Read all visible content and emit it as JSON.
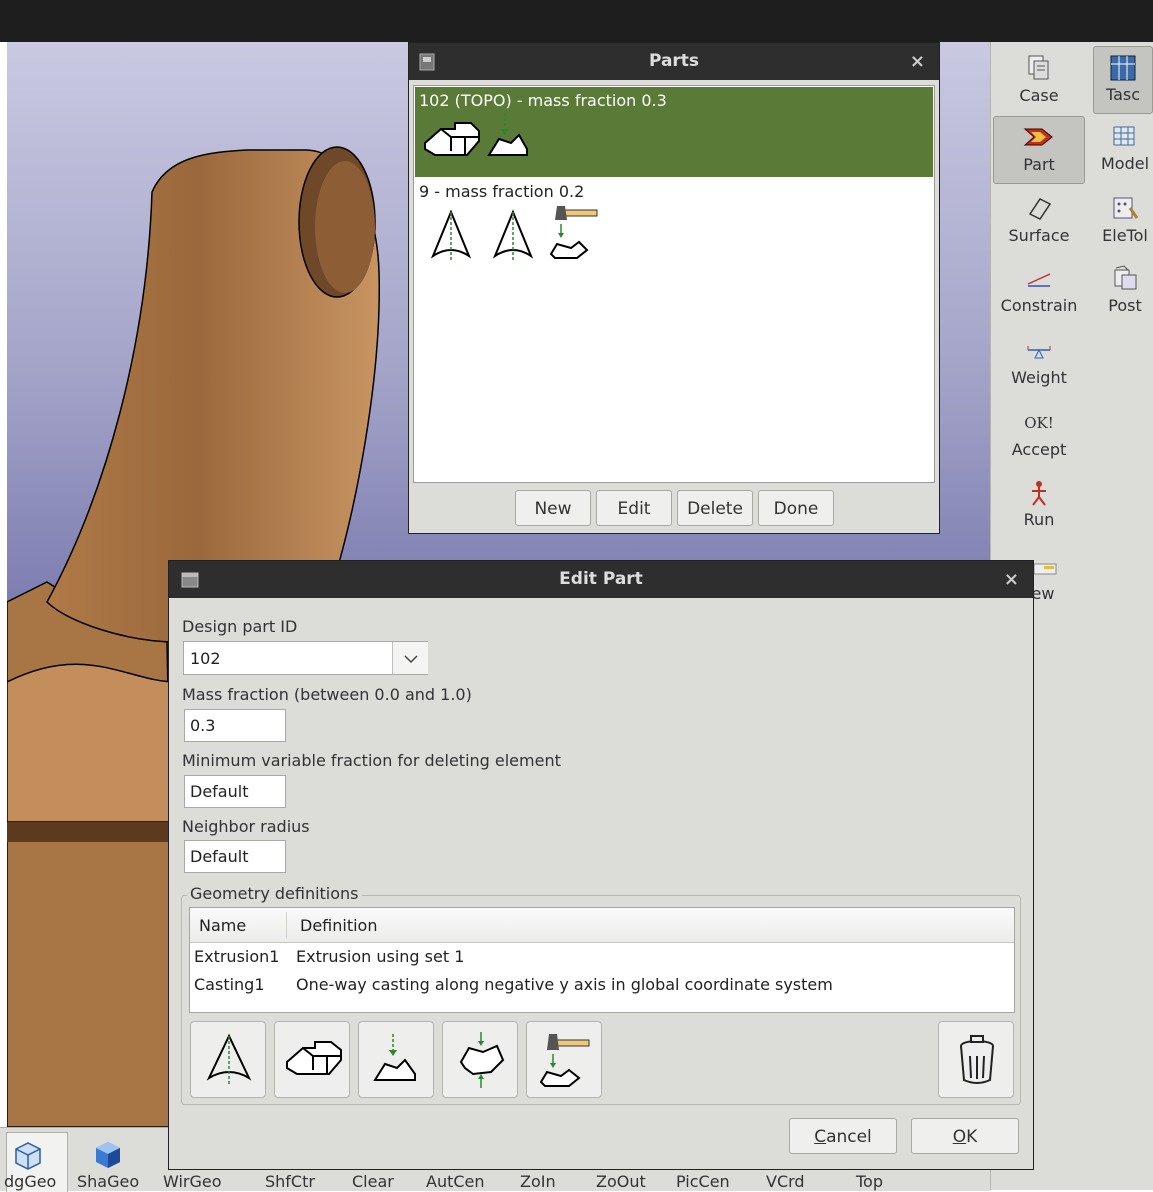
{
  "parts_dialog": {
    "title": "Parts",
    "close": "×",
    "items": [
      {
        "label": "102 (TOPO) - mass fraction 0.3"
      },
      {
        "label": "9 - mass fraction 0.2"
      }
    ],
    "buttons": {
      "new": "New",
      "edit": "Edit",
      "delete": "Delete",
      "done": "Done"
    }
  },
  "edit_part": {
    "title": "Edit Part",
    "close": "×",
    "design_part_id_label": "Design part ID",
    "design_part_id_value": "102",
    "mass_fraction_label": "Mass fraction (between 0.0 and 1.0)",
    "mass_fraction_value": "0.3",
    "min_var_label": "Minimum variable fraction for deleting element",
    "min_var_value": "Default",
    "neighbor_label": "Neighbor radius",
    "neighbor_value": "Default",
    "geometry_group_label": "Geometry definitions",
    "table_headers": {
      "name": "Name",
      "definition": "Definition"
    },
    "geometry_rows": [
      {
        "name": "Extrusion1",
        "definition": "Extrusion using set 1"
      },
      {
        "name": "Casting1",
        "definition": "One-way casting along negative y axis in global coordinate system"
      }
    ],
    "cancel_prefix": "C",
    "cancel_rest": "ancel",
    "ok_prefix": "O",
    "ok_rest": "K"
  },
  "right_toolbar": {
    "case": "Case",
    "tasc": "Tasc",
    "part": "Part",
    "model": "Model",
    "surface": "Surface",
    "eletol": "EleTol",
    "constrain": "Constrain",
    "post": "Post",
    "weight": "Weight",
    "ok_glyph": "OK!",
    "accept": "Accept",
    "run": "Run",
    "view_partial": "ew"
  },
  "bottom_toolbar": {
    "items": [
      "dgGeo",
      "ShaGeo",
      "WirGeo",
      "ShfCtr",
      "Clear",
      "AutCen",
      "ZoIn",
      "ZoOut",
      "PicCen",
      "VCrd",
      "Top"
    ]
  },
  "colors": {
    "selected_row": "#5a7a38",
    "title_bar": "#2e2e2e",
    "part_model": "#c48e5c",
    "viewport_top": "#c9c9e2",
    "viewport_bottom": "#15155a"
  }
}
